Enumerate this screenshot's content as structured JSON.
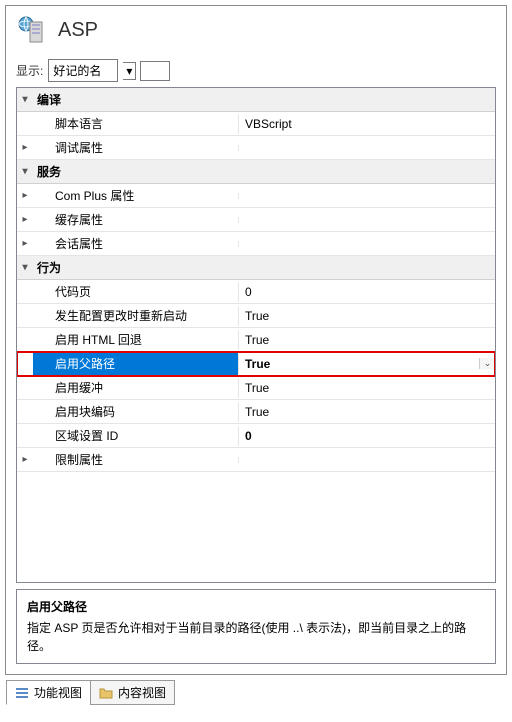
{
  "header": {
    "title": "ASP"
  },
  "filter": {
    "label": "显示:",
    "selected": "好记的名"
  },
  "groups": [
    {
      "name": "编译",
      "expanded": true,
      "rows": [
        {
          "label": "脚本语言",
          "value": "VBScript",
          "expandable": false
        },
        {
          "label": "调试属性",
          "value": "",
          "expandable": true
        }
      ]
    },
    {
      "name": "服务",
      "expanded": true,
      "rows": [
        {
          "label": "Com Plus 属性",
          "value": "",
          "expandable": true
        },
        {
          "label": "缓存属性",
          "value": "",
          "expandable": true
        },
        {
          "label": "会话属性",
          "value": "",
          "expandable": true
        }
      ]
    },
    {
      "name": "行为",
      "expanded": true,
      "rows": [
        {
          "label": "代码页",
          "value": "0",
          "expandable": false
        },
        {
          "label": "发生配置更改时重新启动",
          "value": "True",
          "expandable": false
        },
        {
          "label": "启用 HTML 回退",
          "value": "True",
          "expandable": false
        },
        {
          "label": "启用父路径",
          "value": "True",
          "expandable": false,
          "highlighted": true,
          "dropdown": true
        },
        {
          "label": "启用缓冲",
          "value": "True",
          "expandable": false
        },
        {
          "label": "启用块编码",
          "value": "True",
          "expandable": false
        },
        {
          "label": "区域设置 ID",
          "value": "0",
          "expandable": false,
          "bold": true
        },
        {
          "label": "限制属性",
          "value": "",
          "expandable": true
        }
      ]
    }
  ],
  "description": {
    "title": "启用父路径",
    "text": "指定 ASP 页是否允许相对于当前目录的路径(使用 ..\\ 表示法)，即当前目录之上的路径。"
  },
  "tabs": {
    "feature_view": "功能视图",
    "content_view": "内容视图"
  }
}
